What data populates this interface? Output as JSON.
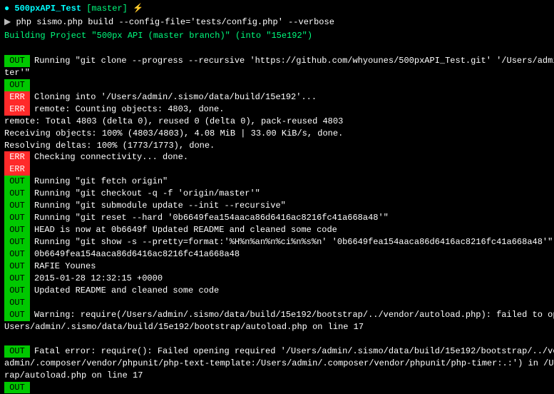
{
  "prompt": {
    "indicator": "●",
    "dir": "500pxAPI_Test",
    "branch": "[master]",
    "lightning": "⚡",
    "arrow": "▶",
    "command": "php sismo.php build --config-file='tests/config.php' --verbose"
  },
  "building": "Building Project \"500px API (master branch)\" (into \"15e192\")",
  "lines": [
    {
      "type": "plain",
      "text": ""
    },
    {
      "type": "badge",
      "badge": "OUT",
      "text": "Running \"git clone --progress --recursive 'https://github.com/whyounes/500pxAPI_Test.git' '/Users/admin/"
    },
    {
      "type": "plain",
      "text": "ter'\""
    },
    {
      "type": "badge",
      "badge": "OUT",
      "text": ""
    },
    {
      "type": "badge",
      "badge": "ERR",
      "text": "Cloning into '/Users/admin/.sismo/data/build/15e192'..."
    },
    {
      "type": "badge",
      "badge": "ERR",
      "text": "remote: Counting objects: 4803, done."
    },
    {
      "type": "plain",
      "text": "remote: Total 4803 (delta 0), reused 0 (delta 0), pack-reused 4803"
    },
    {
      "type": "plain",
      "text": "Receiving objects: 100% (4803/4803), 4.08 MiB | 33.00 KiB/s, done."
    },
    {
      "type": "plain",
      "text": "Resolving deltas: 100% (1773/1773), done."
    },
    {
      "type": "badge",
      "badge": "ERR",
      "text": "Checking connectivity... done."
    },
    {
      "type": "badge",
      "badge": "ERR",
      "text": ""
    },
    {
      "type": "badge",
      "badge": "OUT",
      "text": "Running \"git fetch origin\""
    },
    {
      "type": "badge",
      "badge": "OUT",
      "text": "Running \"git checkout -q -f 'origin/master'\""
    },
    {
      "type": "badge",
      "badge": "OUT",
      "text": "Running \"git submodule update --init --recursive\""
    },
    {
      "type": "badge",
      "badge": "OUT",
      "text": "Running \"git reset --hard '0b6649fea154aaca86d6416ac8216fc41a668a48'\""
    },
    {
      "type": "badge",
      "badge": "OUT",
      "text": "HEAD is now at 0b6649f Updated README and cleaned some code"
    },
    {
      "type": "badge",
      "badge": "OUT",
      "text": "Running \"git show -s --pretty=format:'%H%n%an%n%ci%n%s%n' '0b6649fea154aaca86d6416ac8216fc41a668a48'\""
    },
    {
      "type": "badge",
      "badge": "OUT",
      "text": "0b6649fea154aaca86d6416ac8216fc41a668a48"
    },
    {
      "type": "badge",
      "badge": "OUT",
      "text": "RAFIE Younes"
    },
    {
      "type": "badge",
      "badge": "OUT",
      "text": "2015-01-28 12:32:15 +0000"
    },
    {
      "type": "badge",
      "badge": "OUT",
      "text": "Updated README and cleaned some code"
    },
    {
      "type": "badge",
      "badge": "OUT",
      "text": ""
    },
    {
      "type": "badge",
      "badge": "OUT",
      "text": "Warning: require(/Users/admin/.sismo/data/build/15e192/bootstrap/../vendor/autoload.php): failed to open "
    },
    {
      "type": "plain",
      "text": "Users/admin/.sismo/data/build/15e192/bootstrap/autoload.php on line 17"
    },
    {
      "type": "plain",
      "text": ""
    },
    {
      "type": "badge",
      "badge": "OUT",
      "text": "Fatal error: require(): Failed opening required '/Users/admin/.sismo/data/build/15e192/bootstrap/../vend"
    },
    {
      "type": "plain",
      "text": "admin/.composer/vendor/phpunit/php-text-template:/Users/admin/.composer/vendor/phpunit/php-timer:.:') in /User"
    },
    {
      "type": "plain",
      "text": "rap/autoload.php on line 17"
    },
    {
      "type": "badge",
      "badge": "OUT",
      "text": ""
    }
  ]
}
